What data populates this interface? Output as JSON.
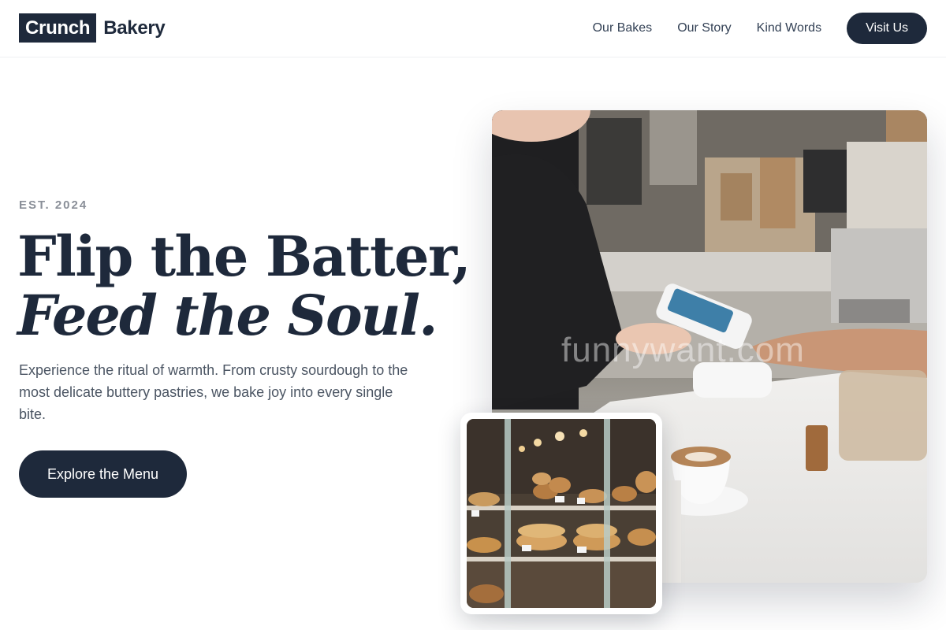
{
  "header": {
    "logo_box": "Crunch",
    "logo_text": "Bakery",
    "nav": [
      "Our Bakes",
      "Our Story",
      "Kind Words"
    ],
    "visit_label": "Visit Us"
  },
  "hero": {
    "eyebrow": "EST. 2024",
    "title_line1": "Flip the Batter,",
    "title_line2": "Feed the Soul.",
    "lead": "Experience the ritual of warmth. From crusty sourdough to the most delicate buttery pastries, we bake joy into every single bite.",
    "cta_label": "Explore the Menu"
  },
  "images": {
    "main_watermark": "funnywant.com"
  },
  "colors": {
    "primary": "#1e293b",
    "muted": "#8a8f98",
    "body_text": "#4b5563"
  }
}
